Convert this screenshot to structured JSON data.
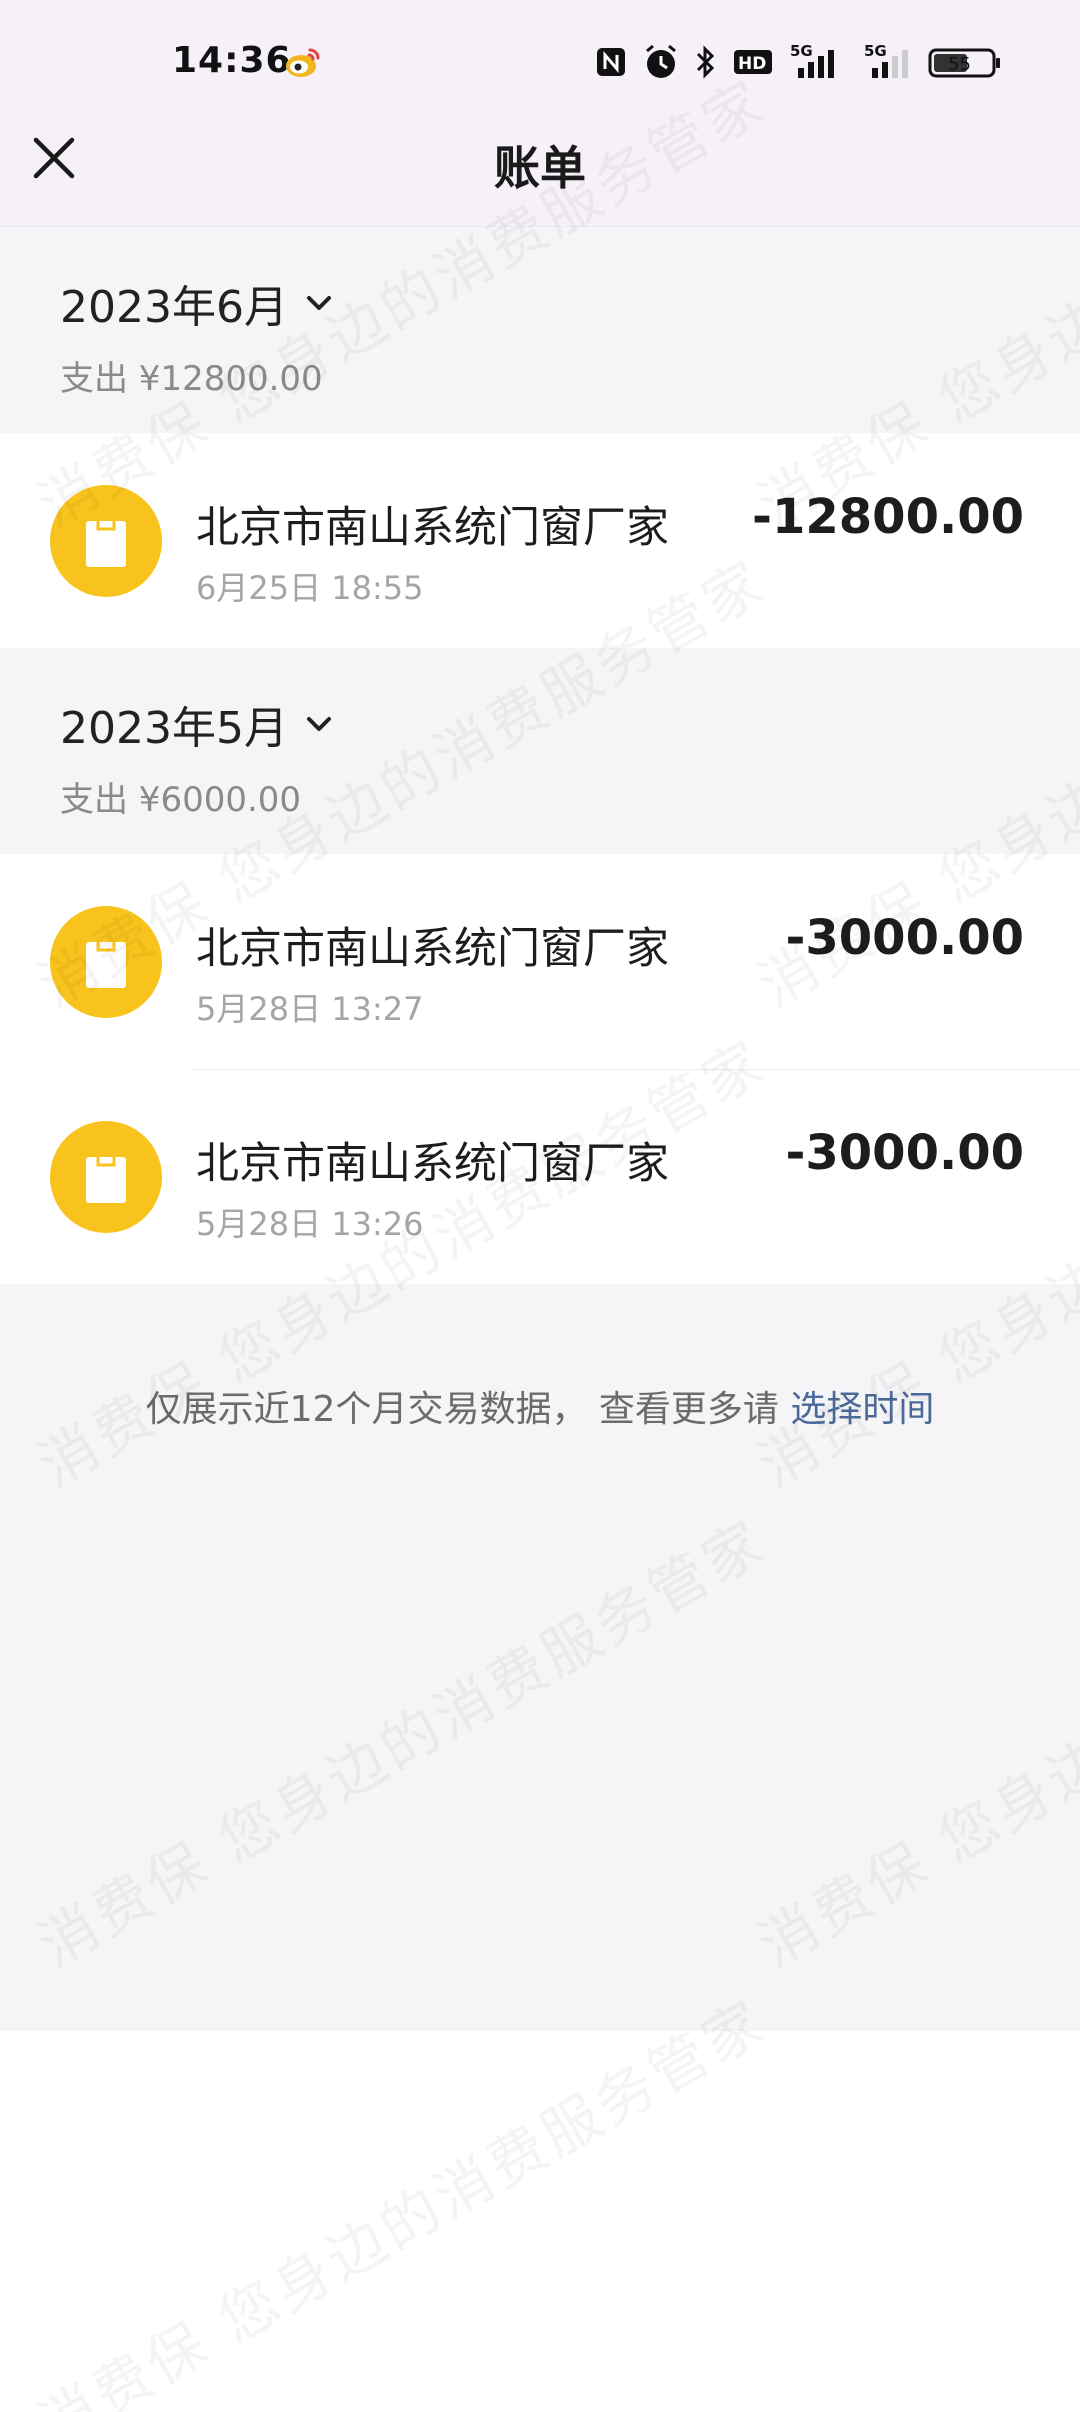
{
  "status_bar": {
    "time": "14:36",
    "network_1": "5G",
    "network_2": "5G",
    "battery": "55"
  },
  "nav": {
    "title": "账单",
    "close_icon": "close-icon"
  },
  "months": [
    {
      "title": "2023年6月",
      "summary": "支出 ¥12800.00",
      "transactions": [
        {
          "merchant": "北京市南山系统门窗厂家",
          "time": "6月25日 18:55",
          "amount": "-12800.00"
        }
      ]
    },
    {
      "title": "2023年5月",
      "summary": "支出 ¥6000.00",
      "transactions": [
        {
          "merchant": "北京市南山系统门窗厂家",
          "time": "5月28日 13:27",
          "amount": "-3000.00"
        },
        {
          "merchant": "北京市南山系统门窗厂家",
          "time": "5月28日 13:26",
          "amount": "-3000.00"
        }
      ]
    }
  ],
  "footer": {
    "note": "仅展示近12个月交易数据， 查看更多请 ",
    "link": "选择时间"
  },
  "watermark": {
    "line_a": "消费保 您身边的消费服务管家",
    "line_b": "消费保 您身边的消费服务管家"
  },
  "colors": {
    "accent_yellow": "#f7c31c",
    "link_blue": "#4b6a9a",
    "header_bg": "#f6f0f8",
    "section_bg": "#f5f5f7"
  }
}
